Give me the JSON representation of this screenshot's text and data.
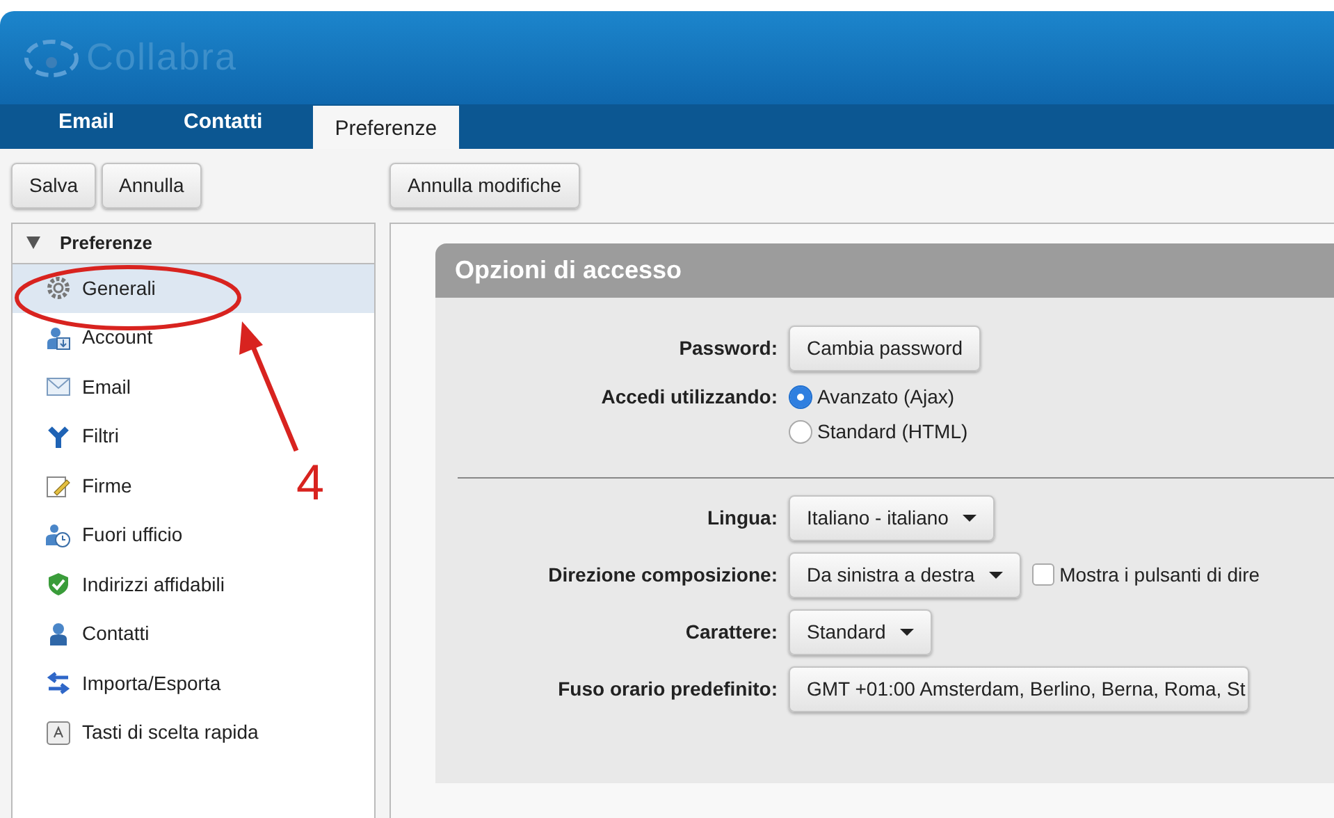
{
  "app": {
    "logo_text": "Collabra"
  },
  "tabs": [
    {
      "label": "Email",
      "selected": false
    },
    {
      "label": "Contatti",
      "selected": false
    },
    {
      "label": "Preferenze",
      "selected": true
    }
  ],
  "toolbar": {
    "left_buttons": [
      "Salva",
      "Annulla"
    ],
    "right_buttons": [
      "Annulla modifiche"
    ]
  },
  "sidebar": {
    "title": "Preferenze",
    "expanded": true,
    "items": [
      {
        "label": "Generali",
        "selected": true
      },
      {
        "label": "Account",
        "selected": false
      },
      {
        "label": "Email",
        "selected": false
      },
      {
        "label": "Filtri",
        "selected": false
      },
      {
        "label": "Firme",
        "selected": false
      },
      {
        "label": "Fuori ufficio",
        "selected": false
      },
      {
        "label": "Indirizzi affidabili",
        "selected": false
      },
      {
        "label": "Contatti",
        "selected": false
      },
      {
        "label": "Importa/Esporta",
        "selected": false
      },
      {
        "label": "Tasti di scelta rapida",
        "selected": false
      }
    ]
  },
  "annotation": {
    "number": "4"
  },
  "section": {
    "title": "Opzioni di accesso",
    "rows": [
      {
        "kind": "button",
        "label": "Password:",
        "value": "Cambia password"
      },
      {
        "kind": "radio",
        "label": "Accedi utilizzando:",
        "options": [
          {
            "label": "Avanzato (Ajax)",
            "selected": true
          },
          {
            "label": "Standard (HTML)",
            "selected": false
          }
        ]
      },
      {
        "kind": "divider"
      },
      {
        "kind": "select",
        "label": "Lingua:",
        "value": "Italiano - italiano"
      },
      {
        "kind": "select",
        "label": "Direzione composizione:",
        "value": "Da sinistra a destra",
        "checkbox": {
          "label": "Mostra i pulsanti di dire",
          "checked": false
        }
      },
      {
        "kind": "select",
        "label": "Carattere:",
        "value": "Standard"
      },
      {
        "kind": "wide_select",
        "label": "Fuso orario predefinito:",
        "value": "GMT +01:00 Amsterdam, Berlino, Berna, Roma, St"
      }
    ]
  }
}
